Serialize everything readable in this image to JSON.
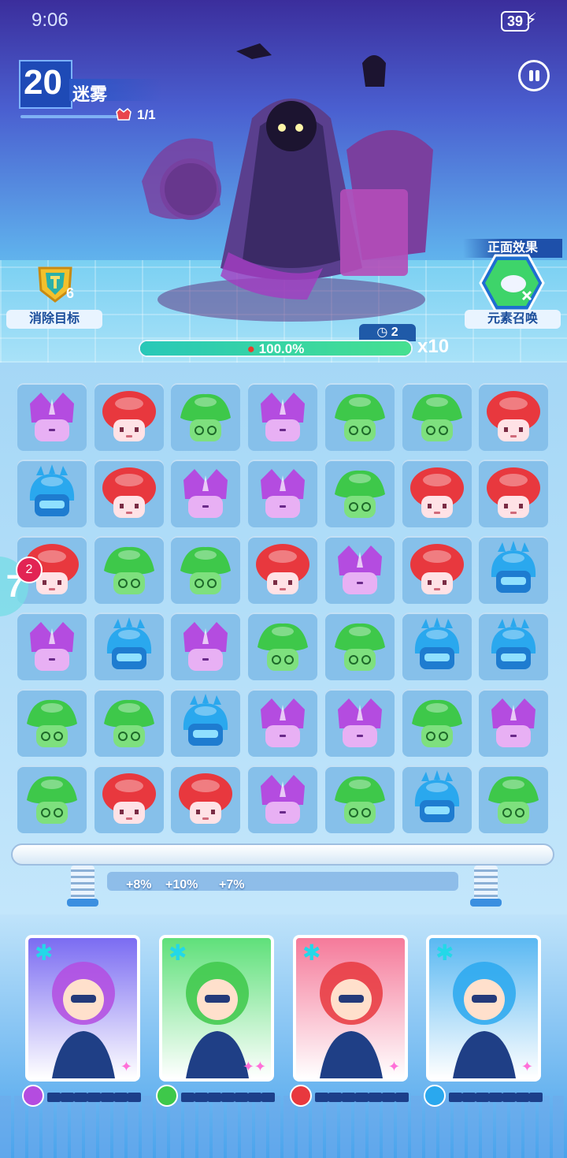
{
  "status_bar": {
    "time": "9:06",
    "battery": "39"
  },
  "level": {
    "number": "20",
    "name": "迷雾",
    "enemy_count": "1/1"
  },
  "objective": {
    "label": "消除目标",
    "count": "6"
  },
  "effect": {
    "title": "正面效果",
    "label": "元素召唤"
  },
  "boss": {
    "timer": "2",
    "hp_text": "100.0%",
    "hp_fraction": 1.0,
    "multiplier": "x10"
  },
  "side_indicator": {
    "badge": "2",
    "text": "7"
  },
  "board": {
    "rows": [
      [
        "purple",
        "red",
        "green",
        "purple",
        "green",
        "green",
        "red"
      ],
      [
        "blue",
        "red",
        "purple",
        "purple",
        "green",
        "red",
        "red"
      ],
      [
        "red",
        "green",
        "green",
        "red",
        "purple",
        "red",
        "blue"
      ],
      [
        "purple",
        "blue",
        "purple",
        "green",
        "green",
        "blue",
        "blue"
      ],
      [
        "green",
        "green",
        "blue",
        "purple",
        "purple",
        "green",
        "purple"
      ],
      [
        "green",
        "red",
        "red",
        "purple",
        "green",
        "blue",
        "green"
      ]
    ]
  },
  "boosts": [
    {
      "text": "+8%"
    },
    {
      "text": "+10%"
    },
    {
      "text": "+7%"
    }
  ],
  "colors": {
    "purple": "#b44ce0",
    "red": "#e8383e",
    "green": "#3ec84a",
    "blue": "#2aa8ee"
  },
  "heroes": [
    {
      "name_icon": "knight-hero",
      "element": "purple",
      "bg": "#7b6cf2",
      "stars": "✦"
    },
    {
      "name_icon": "scientist-hero",
      "element": "green",
      "bg": "#5fe07a",
      "stars": "✦✦"
    },
    {
      "name_icon": "dj-hero",
      "element": "red",
      "bg": "#f57a9a",
      "stars": "✦"
    },
    {
      "name_icon": "bunny-hero",
      "element": "blue",
      "bg": "#5ab8f2",
      "stars": "✦"
    }
  ]
}
